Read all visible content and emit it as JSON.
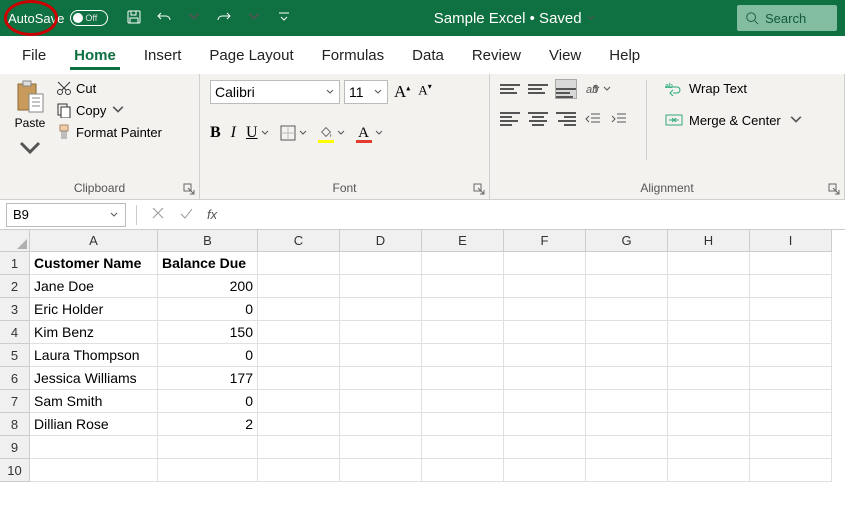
{
  "titlebar": {
    "autosave_label": "AutoSave",
    "autosave_state": "Off",
    "doc_title": "Sample Excel • Saved",
    "search_placeholder": "Search"
  },
  "tabs": [
    "File",
    "Home",
    "Insert",
    "Page Layout",
    "Formulas",
    "Data",
    "Review",
    "View",
    "Help"
  ],
  "active_tab": "Home",
  "ribbon": {
    "clipboard": {
      "paste": "Paste",
      "cut": "Cut",
      "copy": "Copy",
      "format_painter": "Format Painter",
      "label": "Clipboard"
    },
    "font": {
      "name": "Calibri",
      "size": "11",
      "label": "Font",
      "grow": "A",
      "shrink": "A",
      "bold": "B",
      "italic": "I",
      "underline": "U",
      "fill_color": "#ffff00",
      "font_color": "#e33b2e"
    },
    "alignment": {
      "label": "Alignment",
      "wrap": "Wrap Text",
      "merge": "Merge & Center"
    }
  },
  "namebox": "B9",
  "fx_label": "fx",
  "columns": [
    "A",
    "B",
    "C",
    "D",
    "E",
    "F",
    "G",
    "H",
    "I"
  ],
  "rows": [
    {
      "r": 1,
      "A": "Customer Name",
      "B": "Balance Due",
      "hdr": true
    },
    {
      "r": 2,
      "A": "Jane Doe",
      "B": "200"
    },
    {
      "r": 3,
      "A": "Eric Holder",
      "B": "0"
    },
    {
      "r": 4,
      "A": "Kim Benz",
      "B": "150"
    },
    {
      "r": 5,
      "A": "Laura Thompson",
      "B": "0"
    },
    {
      "r": 6,
      "A": "Jessica Williams",
      "B": "177"
    },
    {
      "r": 7,
      "A": "Sam Smith",
      "B": "0"
    },
    {
      "r": 8,
      "A": "Dillian Rose",
      "B": "2"
    },
    {
      "r": 9,
      "A": "",
      "B": ""
    },
    {
      "r": 10,
      "A": "",
      "B": ""
    }
  ]
}
